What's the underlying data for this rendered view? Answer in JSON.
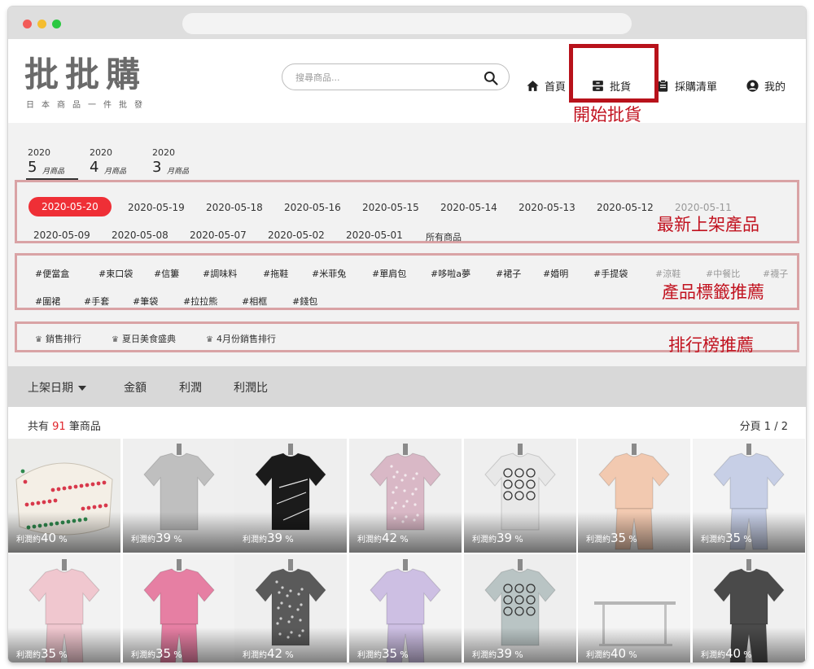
{
  "brand": {
    "name": "批批購",
    "tagline": "日本商品一件批發"
  },
  "search": {
    "placeholder": "搜尋商品..."
  },
  "nav": [
    {
      "label": "首頁",
      "icon": "home-icon"
    },
    {
      "label": "批貨",
      "icon": "archive-box-icon"
    },
    {
      "label": "採購清單",
      "icon": "clipboard-icon"
    },
    {
      "label": "我的",
      "icon": "user-circle-icon"
    }
  ],
  "annotations": {
    "start_wholesale": "開始批貨",
    "latest_products": "最新上架產品",
    "tag_recommend": "產品標籤推薦",
    "ranking_recommend": "排行榜推薦"
  },
  "months": [
    {
      "year": "2020",
      "month": "5",
      "suffix": "月商品",
      "active": true
    },
    {
      "year": "2020",
      "month": "4",
      "suffix": "月商品",
      "active": false
    },
    {
      "year": "2020",
      "month": "3",
      "suffix": "月商品",
      "active": false
    }
  ],
  "dates": [
    "2020-05-20",
    "2020-05-19",
    "2020-05-18",
    "2020-05-16",
    "2020-05-15",
    "2020-05-14",
    "2020-05-13",
    "2020-05-12",
    "2020-05-11",
    "2020-05-09",
    "2020-05-08",
    "2020-05-07",
    "2020-05-02",
    "2020-05-01",
    "所有商品"
  ],
  "tags": [
    "#便當盒",
    "#束口袋",
    "#信簍",
    "#調味料",
    "#拖鞋",
    "#米菲兔",
    "#單肩包",
    "#哆啦a夢",
    "#裙子",
    "#婚明",
    "#手提袋",
    "#涼鞋",
    "#中餐比",
    "#襪子",
    "#圍裙",
    "#手套",
    "#筆袋",
    "#拉拉熊",
    "#相框",
    "#錢包"
  ],
  "rankings": [
    "銷售排行",
    "夏日美食盛典",
    "4月份銷售排行"
  ],
  "sort": [
    "上架日期",
    "金額",
    "利潤",
    "利潤比"
  ],
  "listing": {
    "prefix": "共有",
    "count": "91",
    "suffix": "筆商品",
    "pager": "分頁 1 / 2"
  },
  "profit_label": "利潤約",
  "products": [
    {
      "profit": "40",
      "unit": "%"
    },
    {
      "profit": "39",
      "unit": "%"
    },
    {
      "profit": "39",
      "unit": "%"
    },
    {
      "profit": "42",
      "unit": "%"
    },
    {
      "profit": "39",
      "unit": "%"
    },
    {
      "profit": "35",
      "unit": "%"
    },
    {
      "profit": "35",
      "unit": "%"
    },
    {
      "profit": "35",
      "unit": "%"
    },
    {
      "profit": "35",
      "unit": "%"
    },
    {
      "profit": "42",
      "unit": "%"
    },
    {
      "profit": "35",
      "unit": "%"
    },
    {
      "profit": "39",
      "unit": "%"
    },
    {
      "profit": "40",
      "unit": "%"
    },
    {
      "profit": "40",
      "unit": "%"
    }
  ],
  "colors": {
    "accent": "#ef2f36",
    "highlight_box": "#b8121b",
    "annotation": "#c1121f",
    "panel_border": "#d9a3a5"
  }
}
